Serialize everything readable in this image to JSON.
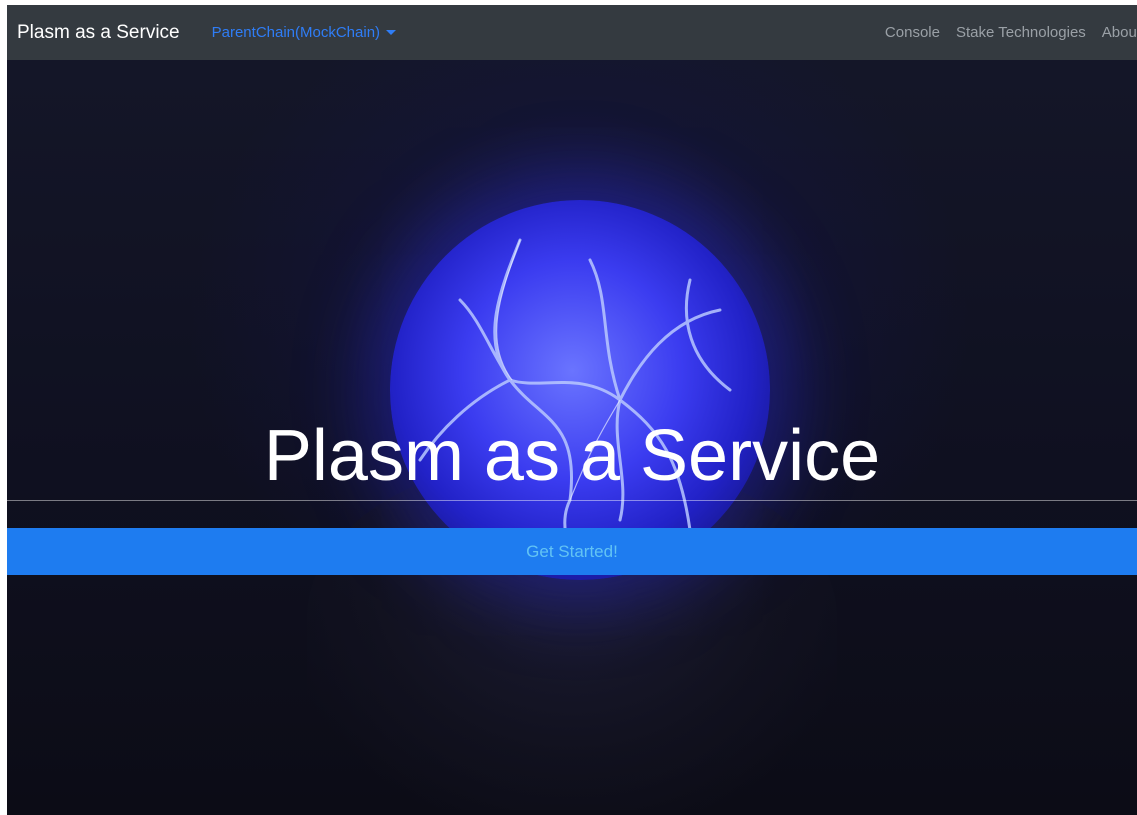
{
  "navbar": {
    "brand": "Plasm as a Service",
    "chain_dropdown": "ParentChain(MockChain)",
    "links": [
      "Console",
      "Stake Technologies",
      "About"
    ]
  },
  "hero": {
    "title": "Plasm as a Service",
    "cta_label": "Get Started!"
  },
  "colors": {
    "navbar_bg": "#343a40",
    "link_active": "#2f7df6",
    "cta_bg": "#1e7cf0",
    "cta_text": "#62c3f4"
  },
  "icons": {
    "dropdown": "caret-down-icon",
    "hero_image": "plasma-globe-image"
  }
}
